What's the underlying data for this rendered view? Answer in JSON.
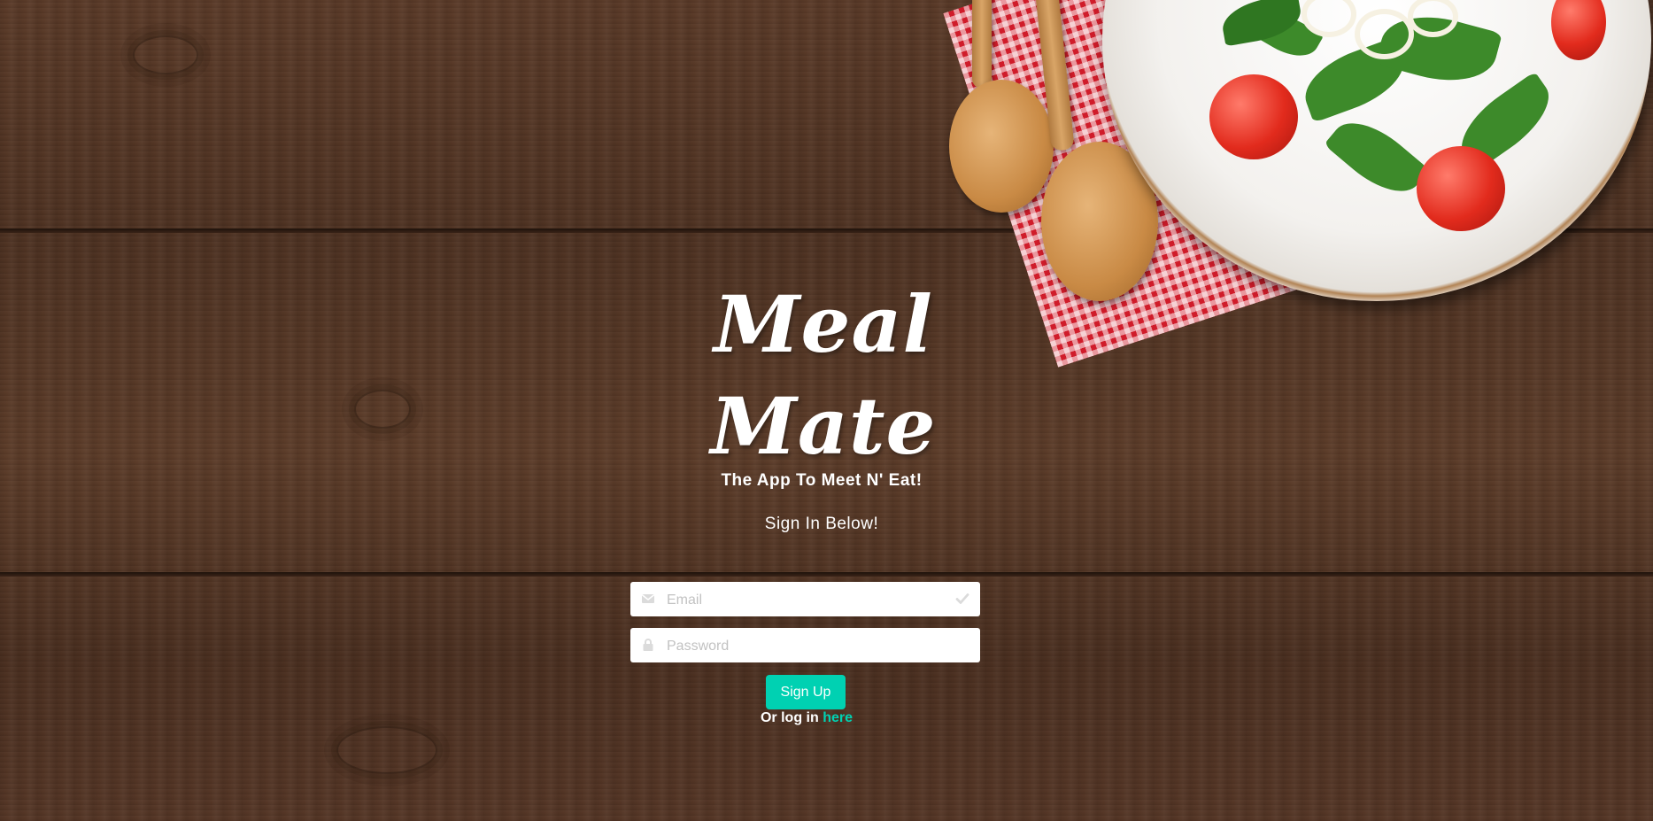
{
  "app": {
    "logo_line1": "Meal",
    "logo_line2": "Mate",
    "tagline": "The App To Meet N' Eat!",
    "signin_heading": "Sign In Below!"
  },
  "form": {
    "email": {
      "value": "",
      "placeholder": "Email",
      "left_icon": "envelope-icon",
      "right_icon": "check-icon"
    },
    "password": {
      "value": "",
      "placeholder": "Password",
      "left_icon": "lock-icon"
    },
    "submit_label": "Sign Up",
    "login_prefix": "Or log in",
    "login_link": "here"
  },
  "colors": {
    "accent": "#00d1b2",
    "text": "#ffffff",
    "field_bg": "#ffffff",
    "icon": "#dbdbdb"
  }
}
